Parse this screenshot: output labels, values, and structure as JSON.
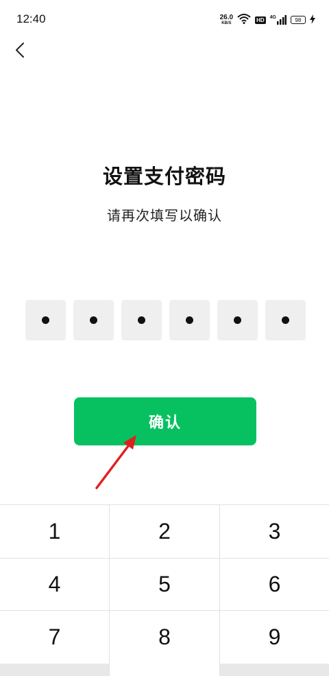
{
  "status_bar": {
    "time": "12:40",
    "net_speed_value": "26.0",
    "net_speed_unit": "KB/S",
    "hd_label": "HD",
    "network_type": "4G",
    "battery_level": "98"
  },
  "page": {
    "title": "设置支付密码",
    "subtitle": "请再次填写以确认",
    "pin_length": 6,
    "pin_filled": 6
  },
  "confirm_button": {
    "label": "确认",
    "color": "#07c160"
  },
  "annotation": {
    "arrow_color": "#e02020"
  },
  "keypad": {
    "keys": [
      "1",
      "2",
      "3",
      "4",
      "5",
      "6",
      "7",
      "8",
      "9"
    ]
  }
}
